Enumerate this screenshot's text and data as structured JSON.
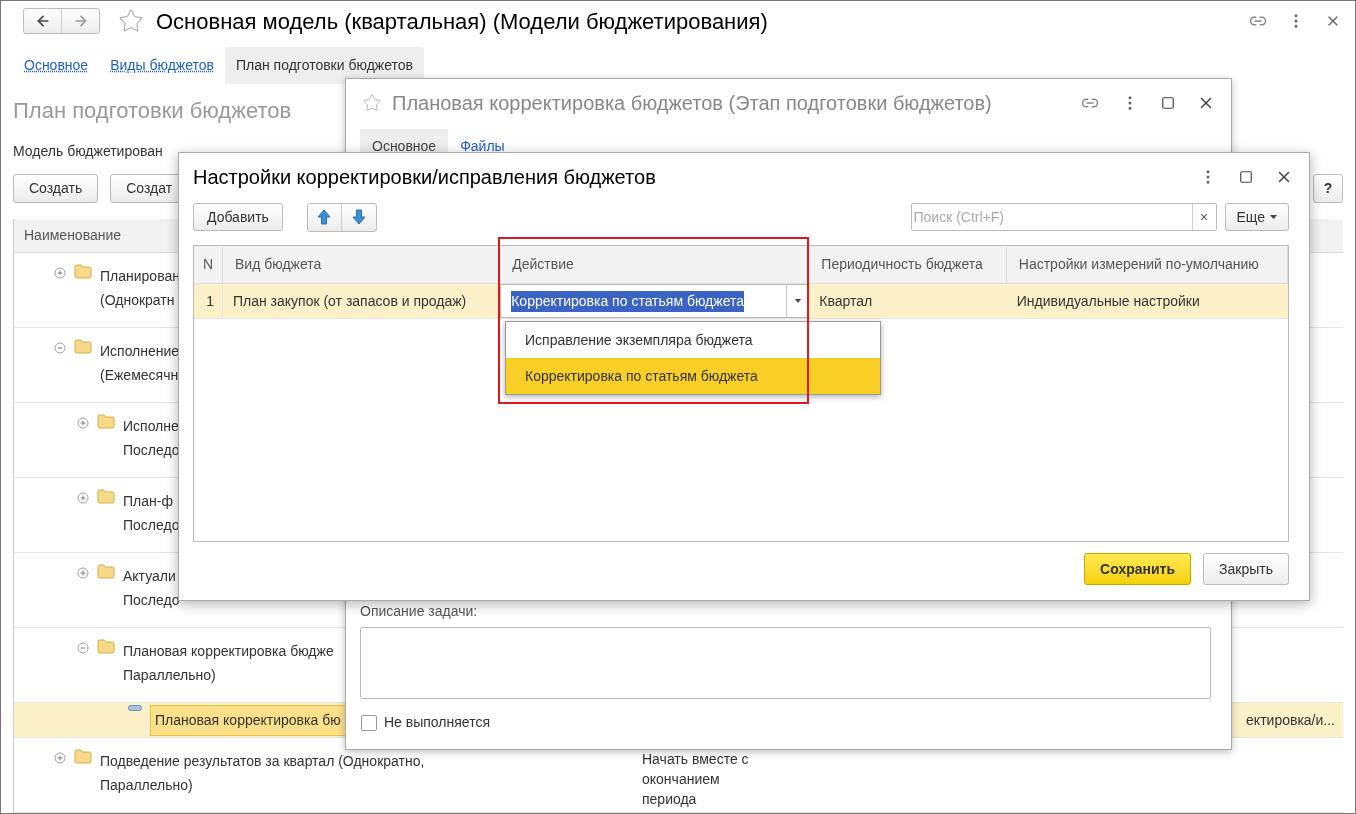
{
  "main_window": {
    "title": "Основная модель (квартальная) (Модели бюджетирования)",
    "tabs": [
      {
        "label": "Основное",
        "selected": false
      },
      {
        "label": "Виды  бюджетов",
        "selected": false
      },
      {
        "label": "План подготовки бюджетов",
        "selected": true
      }
    ],
    "section_title": "План подготовки бюджетов",
    "model_label": "Модель бюджетирован",
    "buttons": [
      "Создать",
      "Создат"
    ],
    "help_button": "?",
    "table": {
      "columns": [
        "Наименование"
      ],
      "rows": [
        {
          "kind": "group",
          "lines": [
            "Планирован",
            "(Однократн"
          ],
          "expanded": false,
          "selected": false
        },
        {
          "kind": "group",
          "lines": [
            "Исполнение",
            "(Ежемесячн"
          ],
          "expanded": true,
          "selected": false,
          "children": [
            {
              "kind": "group",
              "lines": [
                "Исполне",
                "Последо"
              ],
              "expanded": false,
              "selected": false
            },
            {
              "kind": "group",
              "lines": [
                "План-ф",
                "Последо"
              ],
              "expanded": false,
              "selected": false
            },
            {
              "kind": "group",
              "lines": [
                "Актуали",
                "Последо"
              ],
              "expanded": false,
              "selected": false
            },
            {
              "kind": "group",
              "lines": [
                "Плановая корректировка бюдже",
                "Параллельно)"
              ],
              "expanded": true,
              "selected": false,
              "children": [
                {
                  "kind": "item",
                  "lines": [
                    "Плановая корректировка бю"
                  ],
                  "selected": true,
                  "column_3": "ектировка/и..."
                }
              ]
            }
          ]
        },
        {
          "kind": "group",
          "lines": [
            "Подведение результатов за квартал (Однократно,",
            "Параллельно)"
          ],
          "expanded": false,
          "selected": false,
          "column_2": [
            "Начать вместе с",
            "окончанием",
            "периода"
          ]
        }
      ]
    }
  },
  "stage_window": {
    "title": "Плановая корректировка бюджетов (Этап подготовки бюджетов)",
    "tabs": [
      {
        "label": "Основное",
        "selected": true
      },
      {
        "label": "Файлы",
        "selected": false
      }
    ],
    "description_label": "Описание задачи:",
    "checkbox": {
      "label": "Не выполняется",
      "checked": false
    }
  },
  "settings_dialog": {
    "title": "Настройки корректировки/исправления бюджетов",
    "add_button": "Добавить",
    "search": {
      "placeholder": "Поиск (Ctrl+F)",
      "clear": "×"
    },
    "more_button": "Еще",
    "table": {
      "columns": [
        "N",
        "Вид бюджета",
        "Действие",
        "Периодичность бюджета",
        "Настройки измерений по-умолчанию"
      ],
      "rows": [
        {
          "selected": true,
          "cells": [
            "1",
            "План закупок (от запасов и продаж)",
            "Корректировка по статьям бюджета",
            "Квартал",
            "Индивидуальные настройки"
          ]
        }
      ]
    },
    "dropdown": [
      {
        "label": "Исправление экземпляра бюджета",
        "selected": false
      },
      {
        "label": "Корректировка по статьям бюджета",
        "selected": true
      }
    ],
    "save_button": "Сохранить",
    "close_button": "Закрыть"
  }
}
